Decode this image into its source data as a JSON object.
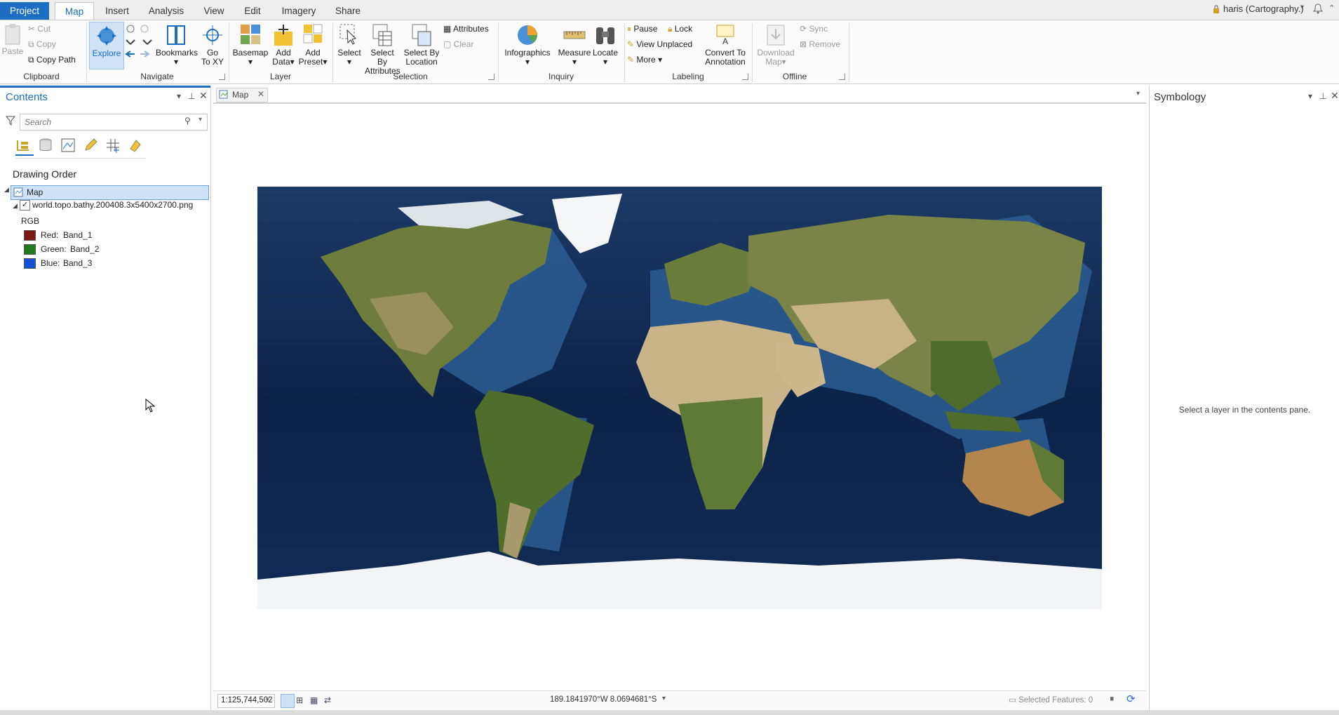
{
  "tabs": {
    "project": "Project",
    "map": "Map",
    "insert": "Insert",
    "analysis": "Analysis",
    "view": "View",
    "edit": "Edit",
    "imagery": "Imagery",
    "share": "Share"
  },
  "user": "haris (Cartography.)",
  "ribbon": {
    "clipboard": {
      "paste": "Paste",
      "cut": "Cut",
      "copy": "Copy",
      "copy_path": "Copy Path",
      "label": "Clipboard"
    },
    "navigate": {
      "explore": "Explore",
      "bookmarks": "Bookmarks",
      "goto_line1": "Go",
      "goto_line2": "To XY",
      "label": "Navigate"
    },
    "layer": {
      "basemap": "Basemap",
      "add_data_1": "Add",
      "add_data_2": "Data",
      "add_preset_1": "Add",
      "add_preset_2": "Preset",
      "label": "Layer"
    },
    "selection": {
      "select": "Select",
      "by_attr_1": "Select By",
      "by_attr_2": "Attributes",
      "by_loc_1": "Select By",
      "by_loc_2": "Location",
      "attributes": "Attributes",
      "clear": "Clear",
      "label": "Selection"
    },
    "inquiry": {
      "infographics": "Infographics",
      "measure": "Measure",
      "locate": "Locate",
      "label": "Inquiry"
    },
    "labeling": {
      "pause": "Pause",
      "lock": "Lock",
      "view_unplaced": "View Unplaced",
      "more": "More",
      "convert_1": "Convert To",
      "convert_2": "Annotation",
      "label": "Labeling"
    },
    "offline": {
      "download_1": "Download",
      "download_2": "Map",
      "sync": "Sync",
      "remove": "Remove",
      "label": "Offline"
    }
  },
  "contents": {
    "title": "Contents",
    "search_placeholder": "Search",
    "drawing_order": "Drawing Order",
    "map_item": "Map",
    "layer_name": "world.topo.bathy.200408.3x5400x2700.png",
    "rgb": "RGB",
    "bands": [
      {
        "label": "Red:",
        "band": "Band_1",
        "color": "#7a1a12"
      },
      {
        "label": "Green:",
        "band": "Band_2",
        "color": "#1f7a1f"
      },
      {
        "label": "Blue:",
        "band": "Band_3",
        "color": "#1450d8"
      }
    ]
  },
  "map_tab": "Map",
  "symbology": {
    "title": "Symbology",
    "message": "Select a layer in the contents pane."
  },
  "status": {
    "scale": "1:125,744,502",
    "coords": "189.1841970°W 8.0694681°S",
    "selected": "Selected Features: 0"
  },
  "colors": {
    "accent": "#1c6ec3",
    "ocean_deep": "#0a1d3c",
    "ocean_shallow": "#2f5f96",
    "land": "#6b7a3a",
    "desert": "#c9b48a",
    "ice": "#f4f6f8"
  }
}
